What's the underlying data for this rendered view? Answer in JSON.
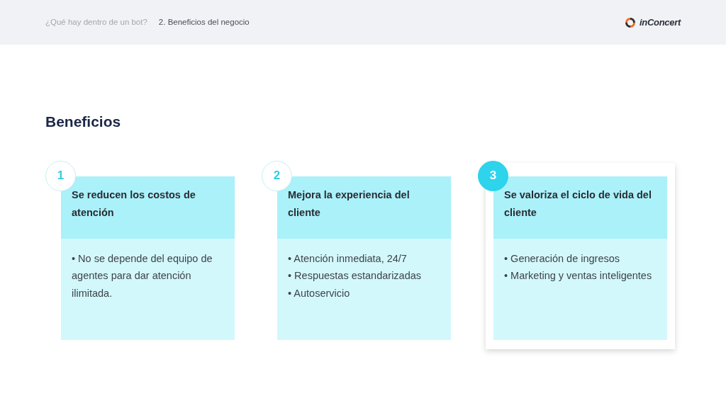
{
  "header": {
    "breadcrumb": [
      {
        "label": "¿Qué hay dentro de un bot?",
        "selected": false
      },
      {
        "label": "2. Beneficios del negocio",
        "selected": true
      }
    ],
    "logo": "inConcert"
  },
  "title": "Beneficios",
  "cards": [
    {
      "number": "1",
      "selected": false,
      "heading": "Se reducen los costos de atención",
      "items": [
        "• No se depende del equipo de agentes para dar atención ilimitada."
      ]
    },
    {
      "number": "2",
      "selected": false,
      "heading": "Mejora la experiencia del cliente",
      "items": [
        "• Atención inmediata, 24/7",
        "• Respuestas estandarizadas",
        "• Autoservicio"
      ]
    },
    {
      "number": "3",
      "selected": true,
      "heading": "Se valoriza el ciclo de vida del cliente",
      "items": [
        "• Generación de ingresos",
        "• Marketing y ventas inteligentes"
      ]
    }
  ]
}
